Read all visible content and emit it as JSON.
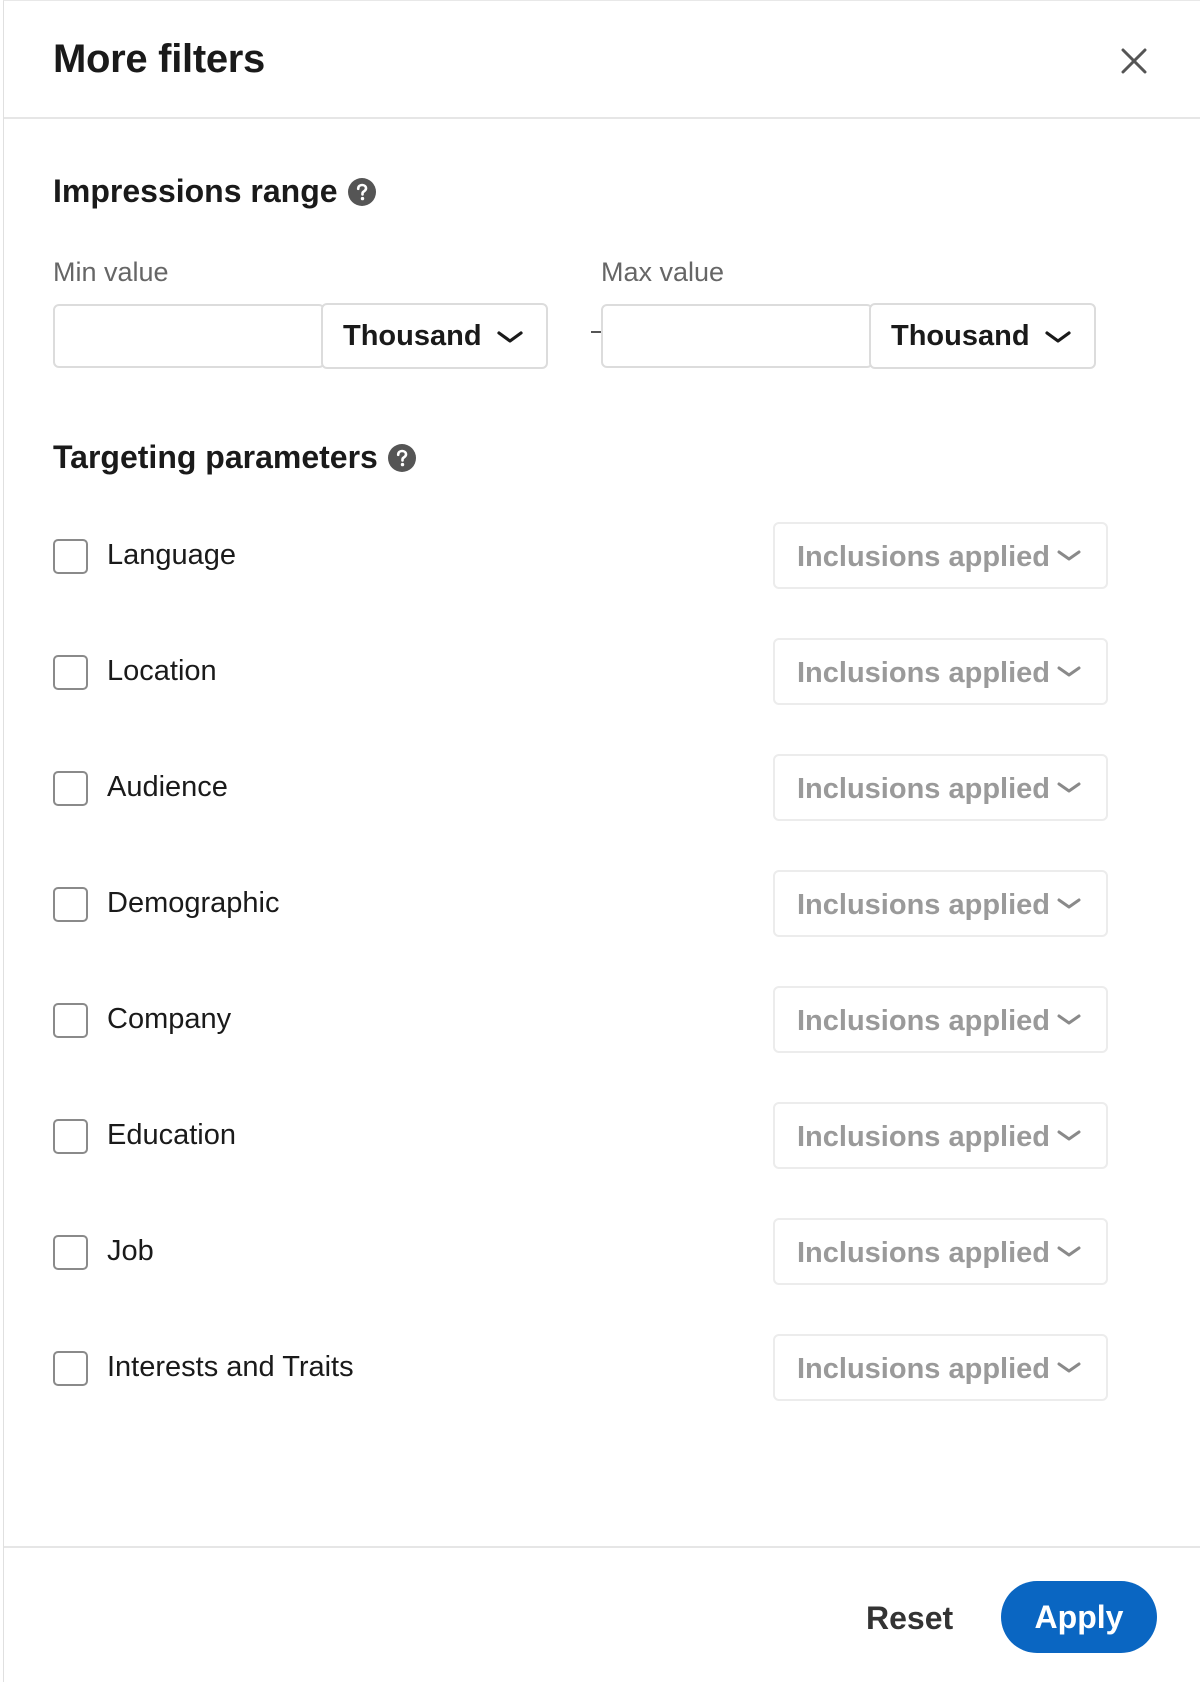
{
  "header": {
    "title": "More filters",
    "close_icon": "close-icon"
  },
  "impressions": {
    "title": "Impressions range",
    "help_icon": "question-circle-icon",
    "min_label": "Min value",
    "min_value": "",
    "min_unit": "Thousand",
    "max_label": "Max value",
    "max_value": "",
    "max_unit": "Thousand"
  },
  "targeting": {
    "title": "Targeting parameters",
    "help_icon": "question-circle-icon",
    "rows": [
      {
        "label": "Language",
        "checked": false,
        "select": "Inclusions applied"
      },
      {
        "label": "Location",
        "checked": false,
        "select": "Inclusions applied"
      },
      {
        "label": "Audience",
        "checked": false,
        "select": "Inclusions applied"
      },
      {
        "label": "Demographic",
        "checked": false,
        "select": "Inclusions applied"
      },
      {
        "label": "Company",
        "checked": false,
        "select": "Inclusions applied"
      },
      {
        "label": "Education",
        "checked": false,
        "select": "Inclusions applied"
      },
      {
        "label": "Job",
        "checked": false,
        "select": "Inclusions applied"
      },
      {
        "label": "Interests and Traits",
        "checked": false,
        "select": "Inclusions applied"
      }
    ]
  },
  "footer": {
    "reset_label": "Reset",
    "apply_label": "Apply"
  },
  "colors": {
    "primary": "#0a66c2",
    "disabled_text": "#9a9a9a"
  }
}
